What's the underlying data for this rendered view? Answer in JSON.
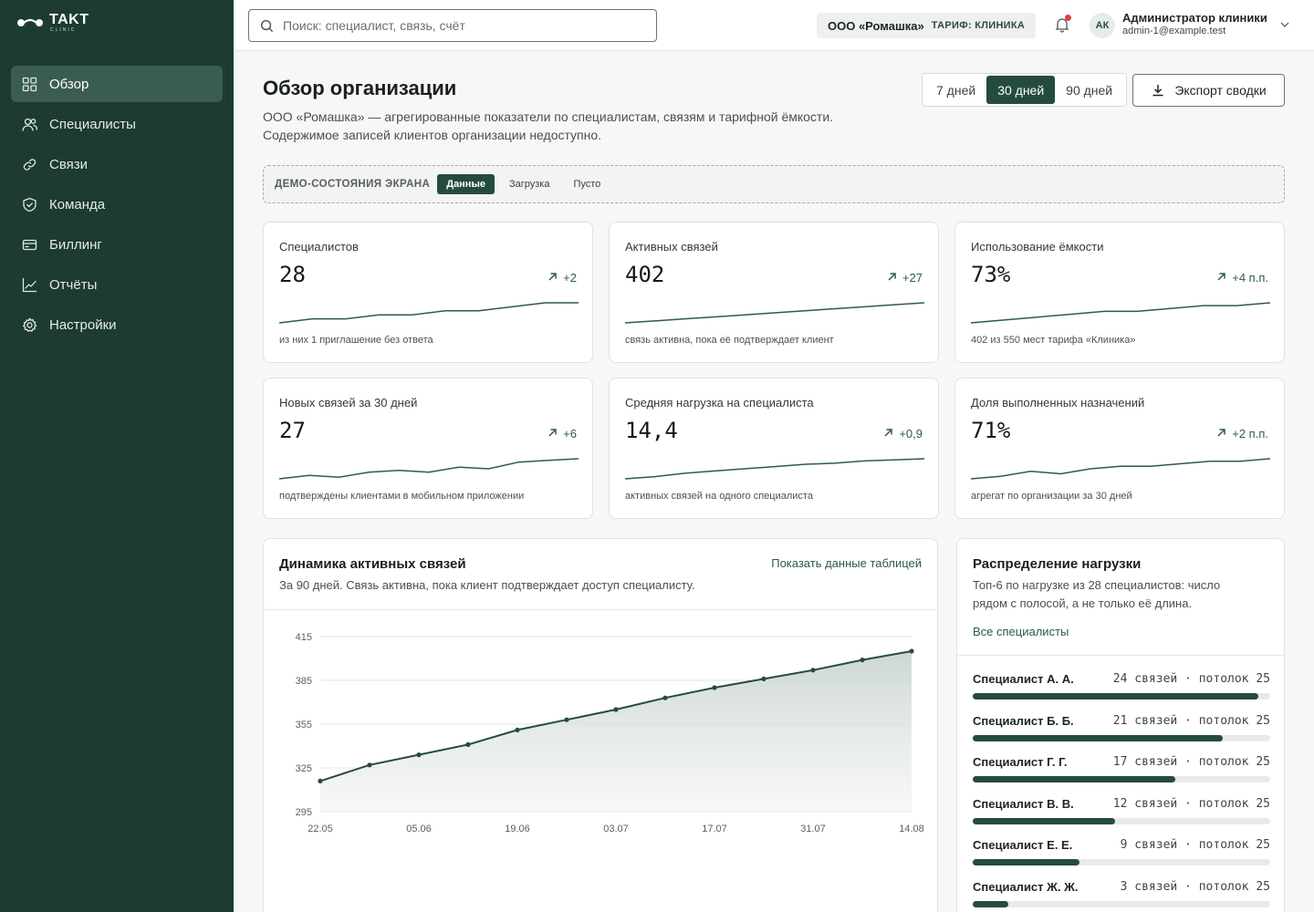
{
  "brand": {
    "name": "TAKT",
    "sub": "CLINIC"
  },
  "sidebar": {
    "items": [
      {
        "label": "Обзор",
        "icon": "grid-icon",
        "active": true
      },
      {
        "label": "Специалисты",
        "icon": "users-icon",
        "active": false
      },
      {
        "label": "Связи",
        "icon": "link-icon",
        "active": false
      },
      {
        "label": "Команда",
        "icon": "shield-icon",
        "active": false
      },
      {
        "label": "Биллинг",
        "icon": "card-icon",
        "active": false
      },
      {
        "label": "Отчёты",
        "icon": "chart-icon",
        "active": false
      },
      {
        "label": "Настройки",
        "icon": "gear-icon",
        "active": false
      }
    ]
  },
  "header": {
    "search_placeholder": "Поиск: специалист, связь, счёт",
    "org_name": "ООО «Ромашка»",
    "org_plan": "ТАРИФ: КЛИНИКА",
    "avatar": "АК",
    "user_name": "Администратор клиники",
    "user_email": "admin-1@example.test"
  },
  "page": {
    "title": "Обзор организации",
    "desc_line1": "ООО «Ромашка» — агрегированные показатели по специалистам, связям и тарифной ёмкости.",
    "desc_line2": "Содержимое записей клиентов организации недоступно.",
    "ranges": [
      "7 дней",
      "30 дней",
      "90 дней"
    ],
    "active_range": "30 дней",
    "export_label": "Экспорт сводки"
  },
  "demo": {
    "label": "ДЕМО-СОСТОЯНИЯ ЭКРАНА",
    "states": [
      "Данные",
      "Загрузка",
      "Пусто"
    ],
    "active": "Данные"
  },
  "kpis": [
    {
      "title": "Специалистов",
      "value": "28",
      "delta": "+2",
      "foot": "из них 1 приглашение без ответа",
      "spark": [
        20,
        21,
        21,
        22,
        22,
        23,
        23,
        24,
        25,
        25
      ]
    },
    {
      "title": "Активных связей",
      "value": "402",
      "delta": "+27",
      "foot": "связь активна, пока её подтверждает клиент",
      "spark": [
        375,
        378,
        381,
        384,
        387,
        390,
        393,
        396,
        399,
        402
      ]
    },
    {
      "title": "Использование ёмкости",
      "value": "73%",
      "delta": "+4 п.п.",
      "foot": "402 из 550 мест тарифа «Клиника»",
      "spark": [
        66,
        67,
        68,
        69,
        70,
        70,
        71,
        72,
        72,
        73
      ]
    },
    {
      "title": "Новых связей за 30 дней",
      "value": "27",
      "delta": "+6",
      "foot": "подтверждены клиентами в мобильном приложении",
      "spark": [
        18,
        19,
        18.5,
        20,
        20.5,
        20,
        21.5,
        21,
        23,
        23.5,
        24
      ]
    },
    {
      "title": "Средняя нагрузка на специалиста",
      "value": "14,4",
      "delta": "+0,9",
      "foot": "активных связей на одного специалиста",
      "spark": [
        13.5,
        13.6,
        13.75,
        13.85,
        13.95,
        14.05,
        14.15,
        14.2,
        14.3,
        14.35,
        14.4
      ]
    },
    {
      "title": "Доля выполненных назначений",
      "value": "71%",
      "delta": "+2 п.п.",
      "foot": "агрегат по организации за 30 дней",
      "spark": [
        67,
        67.5,
        68.5,
        68,
        69,
        69.5,
        69.5,
        70,
        70.5,
        70.5,
        71
      ]
    }
  ],
  "dynamics": {
    "title": "Динамика активных связей",
    "subtitle": "За 90 дней. Связь активна, пока клиент подтверждает доступ специалисту.",
    "link": "Показать данные таблицей"
  },
  "chart_data": {
    "type": "area",
    "x": [
      "22.05",
      "29.05",
      "05.06",
      "12.06",
      "19.06",
      "26.06",
      "03.07",
      "10.07",
      "17.07",
      "24.07",
      "31.07",
      "07.08",
      "14.08"
    ],
    "x_tick_labels": [
      "22.05",
      "05.06",
      "19.06",
      "03.07",
      "17.07",
      "31.07",
      "14.08"
    ],
    "values": [
      316,
      327,
      334,
      341,
      351,
      358,
      365,
      373,
      380,
      386,
      392,
      399,
      405
    ],
    "ylim": [
      295,
      415
    ],
    "y_ticks": [
      "415",
      "385",
      "355",
      "325",
      "295"
    ],
    "grid": true,
    "title": "Динамика активных связей",
    "xlabel": "",
    "ylabel": ""
  },
  "load": {
    "title": "Распределение нагрузки",
    "subtitle_line1": "Топ-6 по нагрузке из 28 специалистов: число",
    "subtitle_line2": "рядом с полосой, а не только её длина.",
    "link": "Все специалисты",
    "unit": "связей",
    "ceiling_label": "потолок",
    "rows": [
      {
        "name": "Специалист А. А.",
        "value": 24,
        "ceiling": 25
      },
      {
        "name": "Специалист Б. Б.",
        "value": 21,
        "ceiling": 25
      },
      {
        "name": "Специалист Г. Г.",
        "value": 17,
        "ceiling": 25
      },
      {
        "name": "Специалист В. В.",
        "value": 12,
        "ceiling": 25
      },
      {
        "name": "Специалист Е. Е.",
        "value": 9,
        "ceiling": 25
      },
      {
        "name": "Специалист Ж. Ж.",
        "value": 3,
        "ceiling": 25
      }
    ]
  }
}
